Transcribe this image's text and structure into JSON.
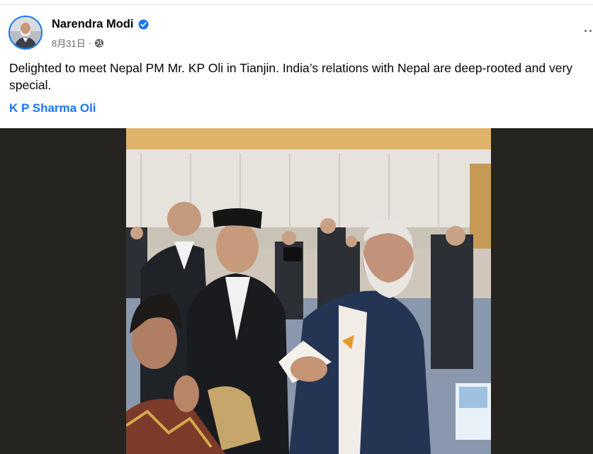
{
  "post": {
    "author_name": "Narendra Modi",
    "date": "8月31日",
    "separator": "·",
    "text": "Delighted to meet Nepal PM Mr. KP Oli in Tianjin. India’s relations with Nepal are deep-rooted and very special.",
    "tagged_person": "K P Sharma Oli",
    "more_label": "··"
  },
  "icons": {
    "verified": "verified-badge-icon",
    "audience": "globe-icon",
    "more": "more-options-icon"
  },
  "colors": {
    "link": "#1877f2",
    "secondary_text": "#65676b",
    "photo_background": "#262421"
  }
}
